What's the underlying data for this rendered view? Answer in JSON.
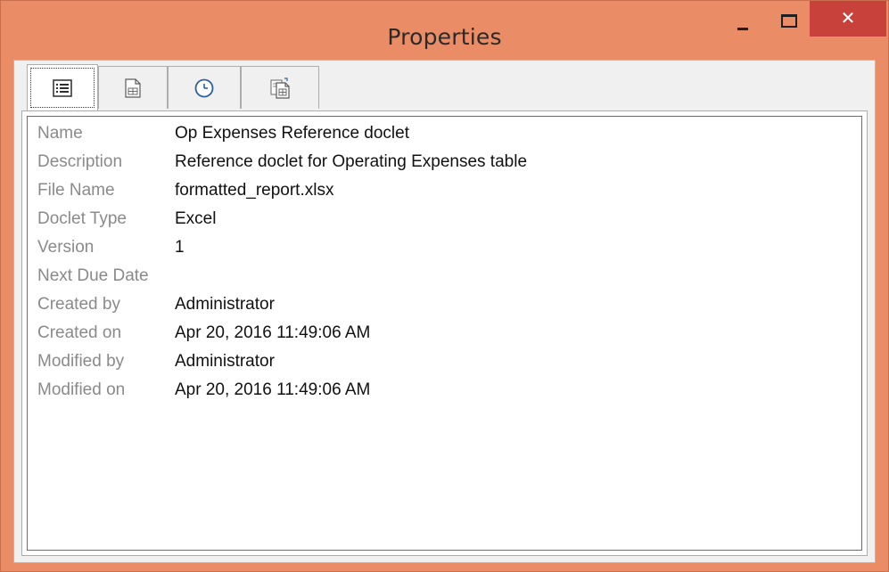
{
  "window": {
    "title": "Properties",
    "minimize_icon": "minimize-icon",
    "maximize_icon": "maximize-icon",
    "close_icon": "close-icon",
    "close_label": "✕"
  },
  "tabs": [
    {
      "icon": "list-properties-icon",
      "selected": true
    },
    {
      "icon": "document-icon",
      "selected": false
    },
    {
      "icon": "clock-icon",
      "selected": false
    },
    {
      "icon": "document-copy-icon",
      "selected": false
    }
  ],
  "properties": [
    {
      "label": "Name",
      "value": "Op Expenses Reference doclet"
    },
    {
      "label": "Description",
      "value": "Reference doclet for Operating Expenses table"
    },
    {
      "label": "File Name",
      "value": "formatted_report.xlsx"
    },
    {
      "label": "Doclet Type",
      "value": "Excel"
    },
    {
      "label": "Version",
      "value": "1"
    },
    {
      "label": "Next Due Date",
      "value": ""
    },
    {
      "label": "Created by",
      "value": "Administrator"
    },
    {
      "label": "Created on",
      "value": "Apr 20, 2016 11:49:06 AM"
    },
    {
      "label": "Modified by",
      "value": "Administrator"
    },
    {
      "label": "Modified on",
      "value": "Apr 20, 2016 11:49:06 AM"
    }
  ],
  "colors": {
    "titlebar": "#ea8c66",
    "close_button": "#c8413a",
    "label_text": "#8a8a8a",
    "value_text": "#111111"
  }
}
